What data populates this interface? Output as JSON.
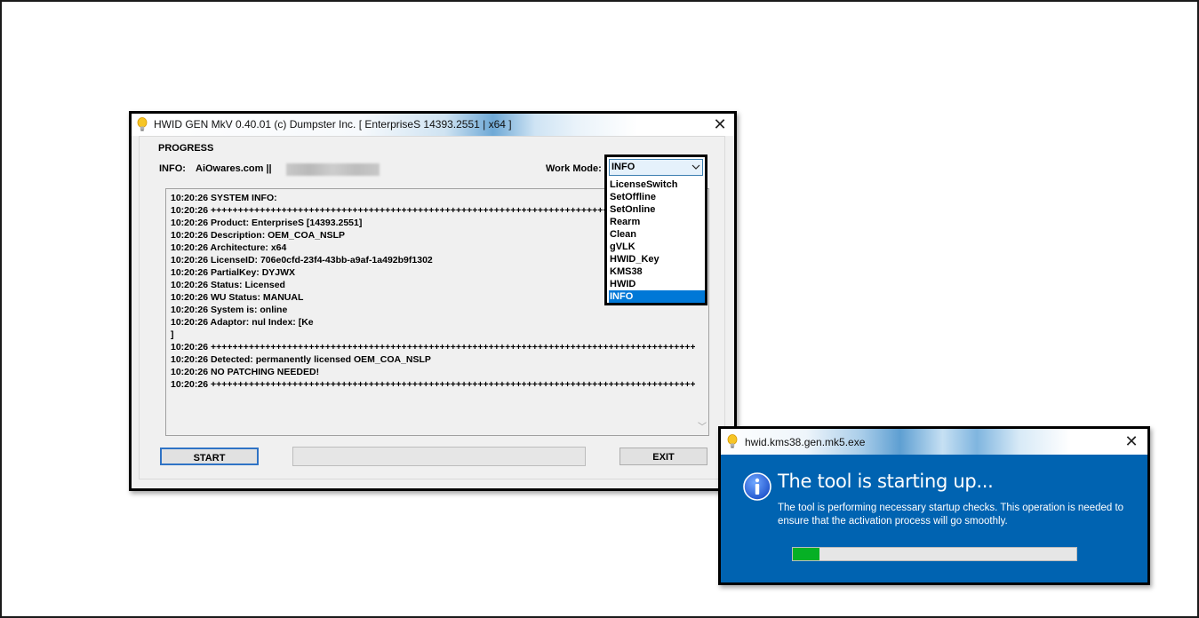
{
  "main_window": {
    "title": "HWID GEN MkV 0.40.01 (c) Dumpster Inc. [ EnterpriseS 14393.2551 | x64 ]",
    "close_glyph": "✕",
    "progress_group_label": "PROGRESS",
    "info_label": "INFO:",
    "info_value": "AiOwares.com ||",
    "work_mode_label": "Work Mode:",
    "work_mode": {
      "selected": "INFO",
      "options": [
        "LicenseSwitch",
        "SetOffline",
        "SetOnline",
        "Rearm",
        "Clean",
        "gVLK",
        "HWID_Key",
        "KMS38",
        "HWID",
        "INFO"
      ],
      "highlighted_option": "INFO"
    },
    "log": [
      "10:20:26 SYSTEM INFO:",
      "10:20:26 ++++++++++++++++++++++++++++++++++++++++++++++++++++++++++++++++++++++++++++++++++++++++++++++++++++++++",
      "10:20:26 Product: EnterpriseS [14393.2551]",
      "10:20:26 Description: OEM_COA_NSLP",
      "10:20:26 Architecture: x64",
      "10:20:26 LicenseID: 706e0cfd-23f4-43bb-a9af-1a492b9f1302",
      "10:20:26 PartialKey: DYJWX",
      "10:20:26 Status: Licensed",
      "10:20:26 WU Status: MANUAL",
      "10:20:26 System is: online",
      "10:20:26 Adaptor: nul Index: [Ke",
      "]",
      "10:20:26 ++++++++++++++++++++++++++++++++++++++++++++++++++++++++++++++++++++++++++++++++++++++++++++++++++++++++",
      "10:20:26 Detected: permanently licensed OEM_COA_NSLP",
      "10:20:26 NO PATCHING NEEDED!",
      "10:20:26 ++++++++++++++++++++++++++++++++++++++++++++++++++++++++++++++++++++++++++++++++++++++++++++++++++++++++"
    ],
    "start_button": "START",
    "exit_button": "EXIT"
  },
  "startup_dialog": {
    "title": "hwid.kms38.gen.mk5.exe",
    "close_glyph": "✕",
    "heading": "The tool is starting up...",
    "body": "The tool is performing necessary startup checks. This operation is needed to ensure that the activation process will go smoothly.",
    "progress_fraction": 0.095
  },
  "colors": {
    "dialog_background": "#0063b1",
    "selection_highlight": "#0078d7",
    "progress_fill": "#06b025",
    "start_button_border": "#2f73c5"
  },
  "icons": {
    "app_icon": "lightbulb-icon",
    "info_icon": "info-icon",
    "chevron": "chevron-down-icon"
  }
}
